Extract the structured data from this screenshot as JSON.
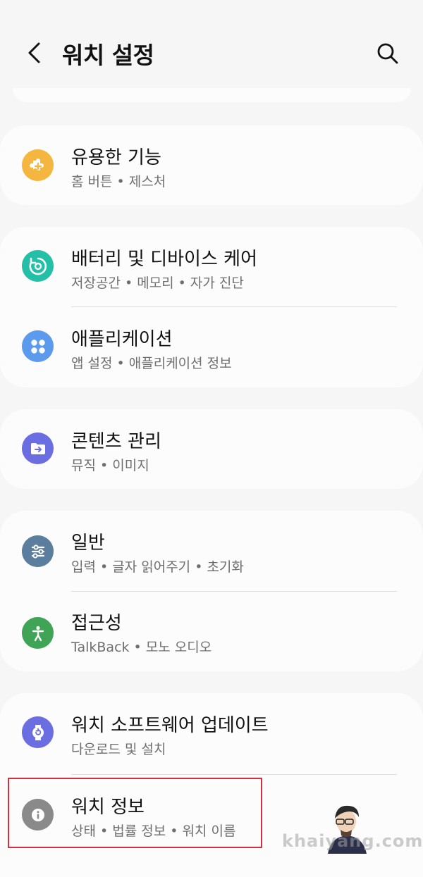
{
  "header": {
    "title": "워치 설정",
    "back_icon": "chevron-left-icon",
    "search_icon": "search-icon"
  },
  "groups": [
    {
      "items": [
        {
          "title": "유용한 기능",
          "subtitle": "홈 버튼 • 제스처",
          "icon": "puzzle-plus-icon",
          "color": "#f5b63f"
        }
      ]
    },
    {
      "items": [
        {
          "title": "배터리 및 디바이스 케어",
          "subtitle": "저장공간 • 메모리 • 자가 진단",
          "icon": "device-care-icon",
          "color": "#24bfa7"
        },
        {
          "title": "애플리케이션",
          "subtitle": "앱 설정 • 애플리케이션 정보",
          "icon": "apps-grid-icon",
          "color": "#5b9aed"
        }
      ]
    },
    {
      "items": [
        {
          "title": "콘텐츠 관리",
          "subtitle": "뮤직 • 이미지",
          "icon": "folder-arrow-icon",
          "color": "#6b6ee0"
        }
      ]
    },
    {
      "items": [
        {
          "title": "일반",
          "subtitle": "입력 • 글자 읽어주기 • 초기화",
          "icon": "sliders-icon",
          "color": "#5b7d9e"
        },
        {
          "title": "접근성",
          "subtitle": "TalkBack • 모노 오디오",
          "icon": "accessibility-icon",
          "color": "#3fa455"
        }
      ]
    },
    {
      "items": [
        {
          "title": "워치 소프트웨어 업데이트",
          "subtitle": "다운로드 및 설치",
          "icon": "watch-update-icon",
          "color": "#6b6ee0"
        },
        {
          "title": "워치 정보",
          "subtitle": "상태 • 법률 정보 • 워치 이름",
          "icon": "info-icon",
          "color": "#8a8a8a"
        }
      ]
    }
  ],
  "highlight_color": "#d22f3f",
  "watermark": "khaiyang.com"
}
